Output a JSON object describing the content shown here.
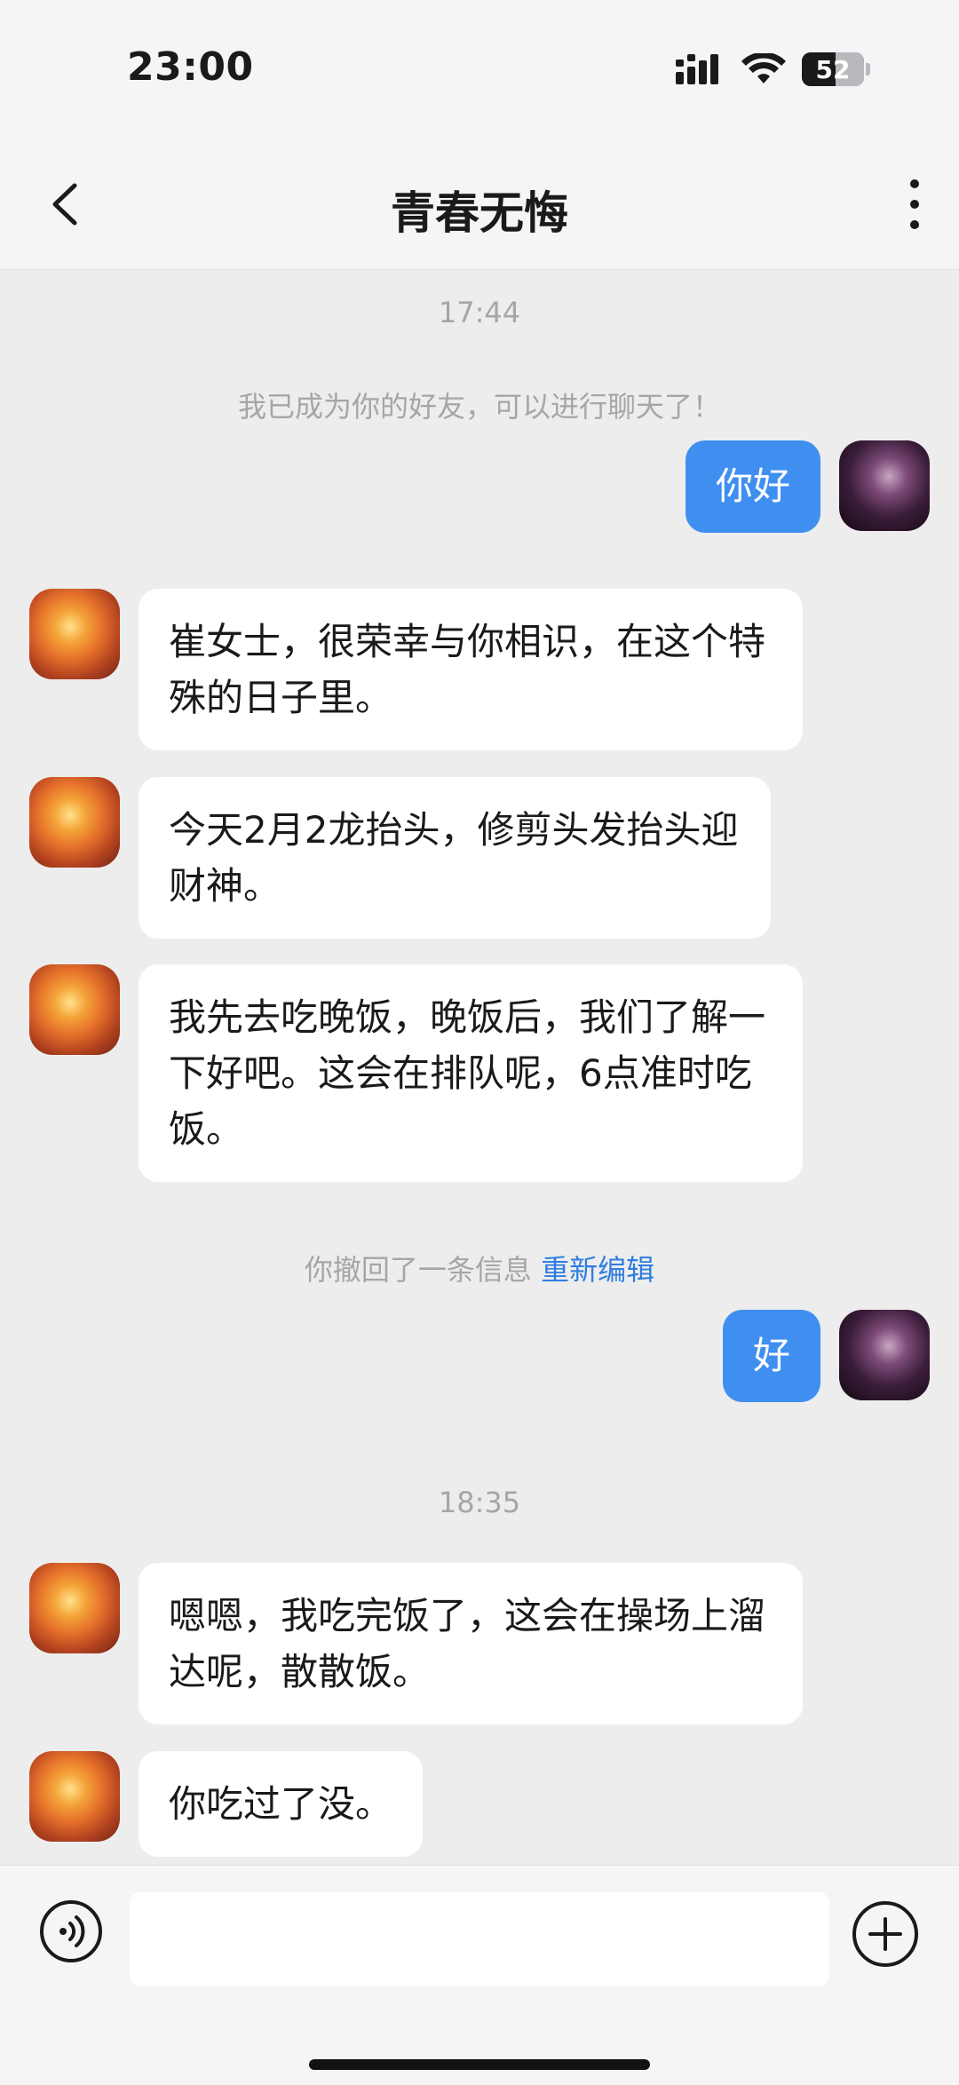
{
  "status_bar": {
    "time": "23:00",
    "battery": "52",
    "battery_level_percent": 52
  },
  "header": {
    "title": "青春无悔",
    "back_icon": "chevron-left-icon",
    "more_icon": "more-vertical-icon"
  },
  "messages": {
    "ts1": "17:44",
    "system_friend": "我已成为你的好友，可以进行聊天了！",
    "m1": "你好",
    "m2": "崔女士，很荣幸与你相识，在这个特殊的日子里。",
    "m3": "今天2月2龙抬头，修剪头发抬头迎财神。",
    "m4": "我先去吃晚饭，晚饭后，我们了解一下好吧。这会在排队呢，6点准时吃饭。",
    "recall_text": "你撤回了一条信息",
    "recall_link": "重新编辑",
    "m5": "好",
    "ts2": "18:35",
    "m6": "嗯嗯，我吃完饭了，这会在操场上溜达呢，散散饭。",
    "m7": "你吃过了没。"
  },
  "input_bar": {
    "voice_icon": "voice-icon",
    "placeholder": "",
    "add_icon": "plus-circle-icon"
  },
  "colors": {
    "self_bubble": "#3f8ff0",
    "link": "#2f7de1",
    "background": "#ededed"
  }
}
